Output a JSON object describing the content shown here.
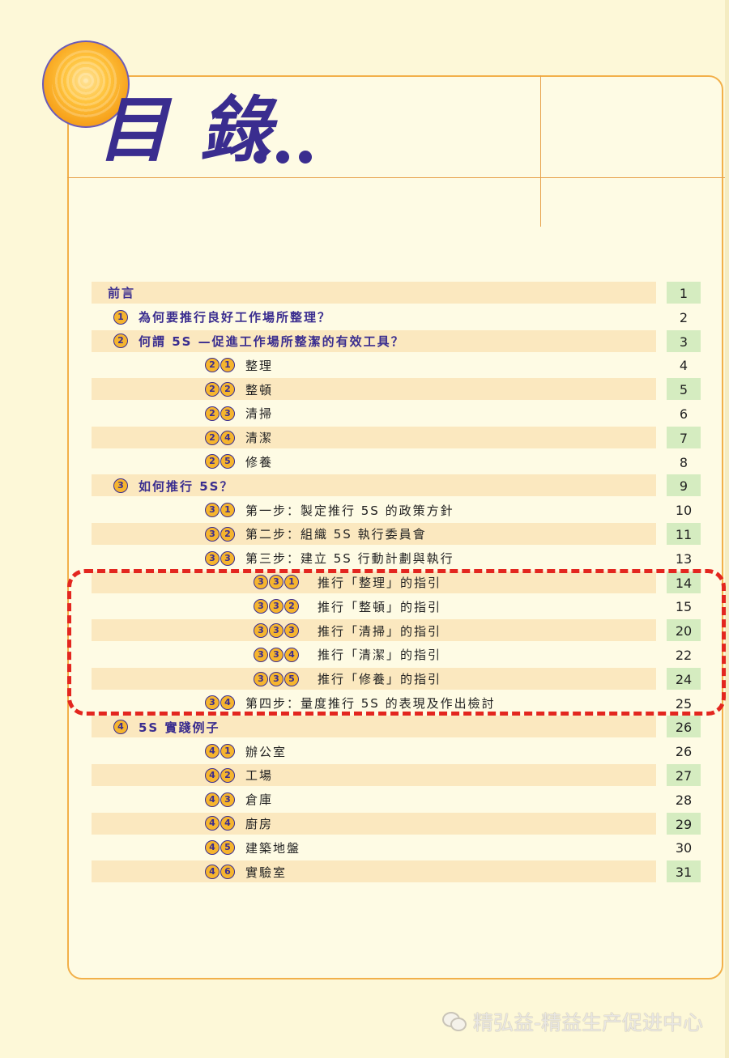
{
  "title": "目 錄",
  "toc": [
    {
      "level": 0,
      "marker": [],
      "text": "前言",
      "page": "1",
      "shaded": true
    },
    {
      "level": 1,
      "marker": [
        "1"
      ],
      "text": "為何要推行良好工作場所整理？",
      "page": "2",
      "shaded": false
    },
    {
      "level": 1,
      "marker": [
        "2"
      ],
      "text": "何謂 5S —促進工作場所整潔的有效工具？",
      "page": "3",
      "shaded": true
    },
    {
      "level": 2,
      "marker": [
        "2",
        "1"
      ],
      "text": "整理",
      "page": "4",
      "shaded": false
    },
    {
      "level": 2,
      "marker": [
        "2",
        "2"
      ],
      "text": "整頓",
      "page": "5",
      "shaded": true
    },
    {
      "level": 2,
      "marker": [
        "2",
        "3"
      ],
      "text": "清掃",
      "page": "6",
      "shaded": false
    },
    {
      "level": 2,
      "marker": [
        "2",
        "4"
      ],
      "text": "清潔",
      "page": "7",
      "shaded": true
    },
    {
      "level": 2,
      "marker": [
        "2",
        "5"
      ],
      "text": "修養",
      "page": "8",
      "shaded": false
    },
    {
      "level": 1,
      "marker": [
        "3"
      ],
      "text": "如何推行 5S？",
      "page": "9",
      "shaded": true
    },
    {
      "level": 2,
      "marker": [
        "3",
        "1"
      ],
      "text": "第一步：製定推行 5S 的政策方針",
      "page": "10",
      "shaded": false
    },
    {
      "level": 2,
      "marker": [
        "3",
        "2"
      ],
      "text": "第二步：組織 5S 執行委員會",
      "page": "11",
      "shaded": true
    },
    {
      "level": 2,
      "marker": [
        "3",
        "3"
      ],
      "text": "第三步：建立 5S 行動計劃與執行",
      "page": "13",
      "shaded": false
    },
    {
      "level": 3,
      "marker": [
        "3",
        "3",
        "1"
      ],
      "text": "推行「整理」的指引",
      "page": "14",
      "shaded": true
    },
    {
      "level": 3,
      "marker": [
        "3",
        "3",
        "2"
      ],
      "text": "推行「整頓」的指引",
      "page": "15",
      "shaded": false
    },
    {
      "level": 3,
      "marker": [
        "3",
        "3",
        "3"
      ],
      "text": "推行「清掃」的指引",
      "page": "20",
      "shaded": true
    },
    {
      "level": 3,
      "marker": [
        "3",
        "3",
        "4"
      ],
      "text": "推行「清潔」的指引",
      "page": "22",
      "shaded": false
    },
    {
      "level": 3,
      "marker": [
        "3",
        "3",
        "5"
      ],
      "text": "推行「修養」的指引",
      "page": "24",
      "shaded": true
    },
    {
      "level": 2,
      "marker": [
        "3",
        "4"
      ],
      "text": "第四步：量度推行 5S 的表現及作出檢討",
      "page": "25",
      "shaded": false
    },
    {
      "level": 1,
      "marker": [
        "4"
      ],
      "text": "5S 實踐例子",
      "page": "26",
      "shaded": true
    },
    {
      "level": 2,
      "marker": [
        "4",
        "1"
      ],
      "text": "辦公室",
      "page": "26",
      "shaded": false
    },
    {
      "level": 2,
      "marker": [
        "4",
        "2"
      ],
      "text": "工場",
      "page": "27",
      "shaded": true
    },
    {
      "level": 2,
      "marker": [
        "4",
        "3"
      ],
      "text": "倉庫",
      "page": "28",
      "shaded": false
    },
    {
      "level": 2,
      "marker": [
        "4",
        "4"
      ],
      "text": "廚房",
      "page": "29",
      "shaded": true
    },
    {
      "level": 2,
      "marker": [
        "4",
        "5"
      ],
      "text": "建築地盤",
      "page": "30",
      "shaded": false
    },
    {
      "level": 2,
      "marker": [
        "4",
        "6"
      ],
      "text": "實驗室",
      "page": "31",
      "shaded": true
    }
  ],
  "watermark": "精弘益-精益生产促进中心",
  "colors": {
    "accent": "#3a2d8f",
    "border": "#f2b04a",
    "row_shade": "#fbe8bf",
    "page_shade": "#d5ecc0",
    "highlight": "#e3261f"
  }
}
